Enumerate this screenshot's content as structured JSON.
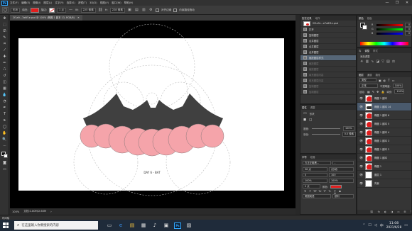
{
  "app": {
    "logo": "Ps",
    "menu": [
      "文件(F)",
      "编辑(E)",
      "图像(I)",
      "图层(L)",
      "文字(Y)",
      "选择(S)",
      "滤镜(T)",
      "3D(D)",
      "视图(V)",
      "窗口(W)",
      "帮助(H)"
    ],
    "window_controls": [
      "—",
      "❐",
      "✕"
    ]
  },
  "options": {
    "mode": "形状",
    "fill_label": "填充:",
    "stroke_label": "描边:",
    "stroke_width": "1 点",
    "w_label": "W:",
    "w_value": "225 像素",
    "h_label": "H:",
    "h_value": "228 像素",
    "align_edges": "对齐边缘",
    "constrain_paths": "约束路径拖动",
    "fill_color": "#e21d1d",
    "stroke_color": "#ffffff"
  },
  "document": {
    "tab_title": "2f1a9...7a6f1e.psd @ 100% (椭圆 1 副本 13, RGB/8)",
    "zoom": "100%",
    "doc_info": "文档:1.80M/2.60M",
    "caption": "DAY 6 - BAT",
    "bat_color": "#404040",
    "circle_color": "#f5a4aa",
    "circle_stroke": "#8c7a7c"
  },
  "status": {
    "timeline": "时间轴"
  },
  "history": {
    "tabs": [
      "历史记录",
      "动作"
    ],
    "snapshot": "2f1a9c...e7a6f1e.psd",
    "items": [
      {
        "label": "打开",
        "active": false,
        "dim": false
      },
      {
        "label": "复制图层",
        "active": false,
        "dim": false
      },
      {
        "label": "合并图层",
        "active": false,
        "dim": false
      },
      {
        "label": "合并图层",
        "active": false,
        "dim": false
      },
      {
        "label": "合并图层",
        "active": false,
        "dim": false
      },
      {
        "label": "缩放图层样式",
        "active": true,
        "dim": false
      },
      {
        "label": "缩放图层",
        "active": false,
        "dim": true
      },
      {
        "label": "缩放图层",
        "active": false,
        "dim": true
      },
      {
        "label": "填充图层内容",
        "active": false,
        "dim": true
      },
      {
        "label": "填充图层内容",
        "active": false,
        "dim": true
      },
      {
        "label": "复制图层",
        "active": false,
        "dim": true
      },
      {
        "label": "复制图层",
        "active": false,
        "dim": true
      }
    ]
  },
  "properties": {
    "tabs": [
      "属性",
      "调整"
    ],
    "type": "形状",
    "density_label": "密度:",
    "density_value": "100%",
    "feather_label": "羽化:",
    "feather_value": "0.0 像素",
    "buttons": [
      "选择并遮住...",
      "颜色范围...",
      "反相"
    ]
  },
  "character": {
    "tabs": [
      "字符",
      "段落"
    ],
    "font": "方正正粗黑...",
    "style": "-",
    "size": "36 点",
    "leading": "(自动)",
    "tracking": "0",
    "kerning": "100",
    "scale_v": "100%",
    "scale_h": "100%",
    "baseline": "0 点",
    "color_label": "颜色:",
    "style_buttons": [
      "T",
      "T",
      "TT",
      "Tr",
      "T¹",
      "T₁",
      "T",
      "T"
    ],
    "lang": "美国英语",
    "aa": "锐利"
  },
  "color": {
    "tabs": [
      "颜色",
      "色板"
    ],
    "channels": [
      {
        "label": "R",
        "value": "0",
        "gradient": "linear-gradient(to right, #000, #f00)"
      },
      {
        "label": "G",
        "value": "0",
        "gradient": "linear-gradient(to right, #000, #0f0)"
      },
      {
        "label": "B",
        "value": "0",
        "gradient": "linear-gradient(to right, #000, #00f)"
      }
    ]
  },
  "libraries": {
    "tabs": [
      "库",
      "调整",
      "样式"
    ],
    "title": "添加调整"
  },
  "layers": {
    "tabs": [
      "图层",
      "通道",
      "路径"
    ],
    "kind_label": "类型",
    "blend_mode": "正常",
    "opacity_label": "不透明度:",
    "opacity_value": "100%",
    "lock_label": "锁定:",
    "fill_label": "填充:",
    "fill_value": "100%",
    "items": [
      {
        "name": "椭圆 1 副本",
        "thumb": "red",
        "fx": "",
        "selected": false
      },
      {
        "name": "椭圆 1 副本 14",
        "thumb": "bat",
        "fx": "",
        "selected": true
      },
      {
        "name": "椭圆 1 副本 6",
        "thumb": "red",
        "fx": "",
        "selected": false
      },
      {
        "name": "椭圆 1 副本 5",
        "thumb": "red",
        "fx": "",
        "selected": false
      },
      {
        "name": "椭圆 1 副本 4",
        "thumb": "red",
        "fx": "",
        "selected": false
      },
      {
        "name": "椭圆 1 副本 3",
        "thumb": "red",
        "fx": "",
        "selected": false
      },
      {
        "name": "椭圆 1 副本 2",
        "thumb": "red",
        "fx": "",
        "selected": false
      },
      {
        "name": "椭圆 1 副本",
        "thumb": "red",
        "fx": "",
        "selected": false
      },
      {
        "name": "椭圆 1",
        "thumb": "red",
        "fx": "",
        "selected": false
      },
      {
        "name": "图层 1",
        "thumb": "white",
        "fx": "",
        "selected": false
      },
      {
        "name": "背景",
        "thumb": "bg",
        "fx": "",
        "selected": false
      }
    ],
    "bottom_icons": [
      "⛓",
      "fx",
      "◐",
      "◑",
      "▭",
      "⊞",
      "🗑"
    ]
  },
  "taskbar": {
    "search_placeholder": "在这里输入你要搜索的内容",
    "time": "11:08",
    "date": "2021/6/28",
    "apps": [
      "▭",
      "e",
      "▤",
      "▦",
      "♪",
      "▣",
      "Ps",
      "▨"
    ]
  }
}
